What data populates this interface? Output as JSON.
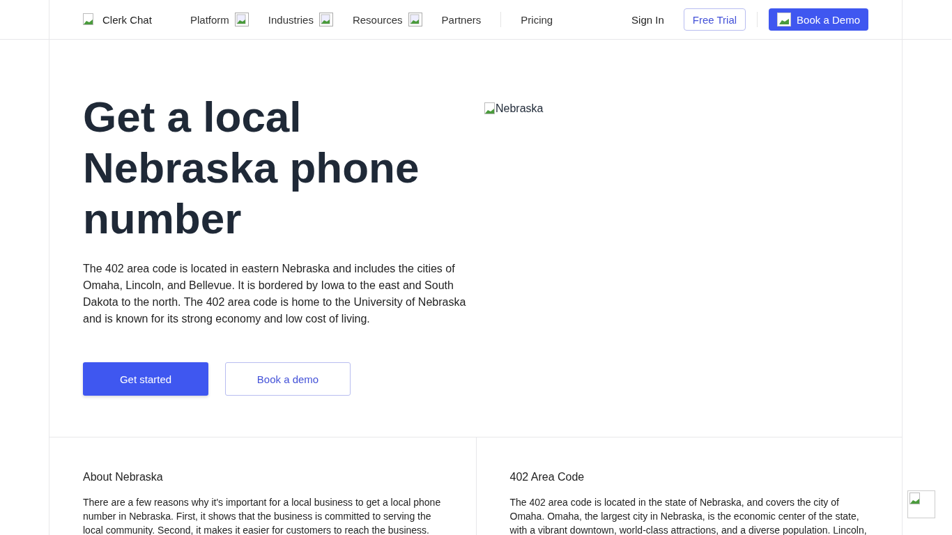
{
  "header": {
    "brand": "Clerk Chat",
    "nav": [
      {
        "label": "Platform",
        "kind": "menu"
      },
      {
        "label": "Industries",
        "kind": "menu"
      },
      {
        "label": "Resources",
        "kind": "menu"
      },
      {
        "label": "Partners",
        "kind": "link"
      },
      {
        "label": "Pricing",
        "kind": "link"
      }
    ],
    "sign_in": "Sign In",
    "free_trial": "Free Trial",
    "book_demo": "Book a Demo"
  },
  "hero": {
    "title": "Get a local Nebraska phone number",
    "text": "The 402 area code is located in eastern Nebraska and includes the cities of Omaha, Lincoln, and Bellevue. It is bordered by Iowa to the east and South Dakota to the north. The 402 area code is home to the University of Nebraska and is known for its strong economy and low cost of living.",
    "primary_button": "Get started",
    "secondary_button": "Book a demo",
    "image_alt": "Nebraska"
  },
  "sections": [
    {
      "heading": "About Nebraska",
      "text": "There are a few reasons why it's important for a local business to get a local phone number in Nebraska. First, it shows that the business is committed to serving the local community. Second, it makes it easier for customers to reach the business."
    },
    {
      "heading": "402 Area Code",
      "text": "The 402 area code is located in the state of Nebraska, and covers the city of Omaha. Omaha, the largest city in Nebraska, is the economic center of the state, with a vibrant downtown, world-class attractions, and a diverse population. Lincoln,"
    }
  ]
}
